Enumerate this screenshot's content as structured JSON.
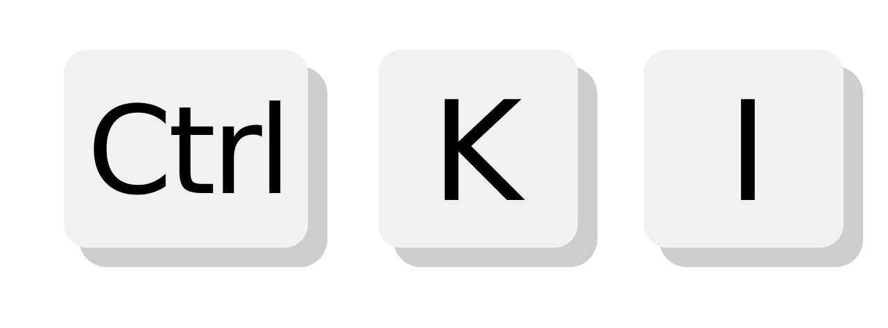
{
  "keys": [
    {
      "label": "Ctrl"
    },
    {
      "label": "K"
    },
    {
      "label": "I"
    }
  ],
  "colors": {
    "background": "#ffffff",
    "key_face": "#f1f1f1",
    "key_shadow": "#cdcdcd",
    "text": "#000000"
  }
}
